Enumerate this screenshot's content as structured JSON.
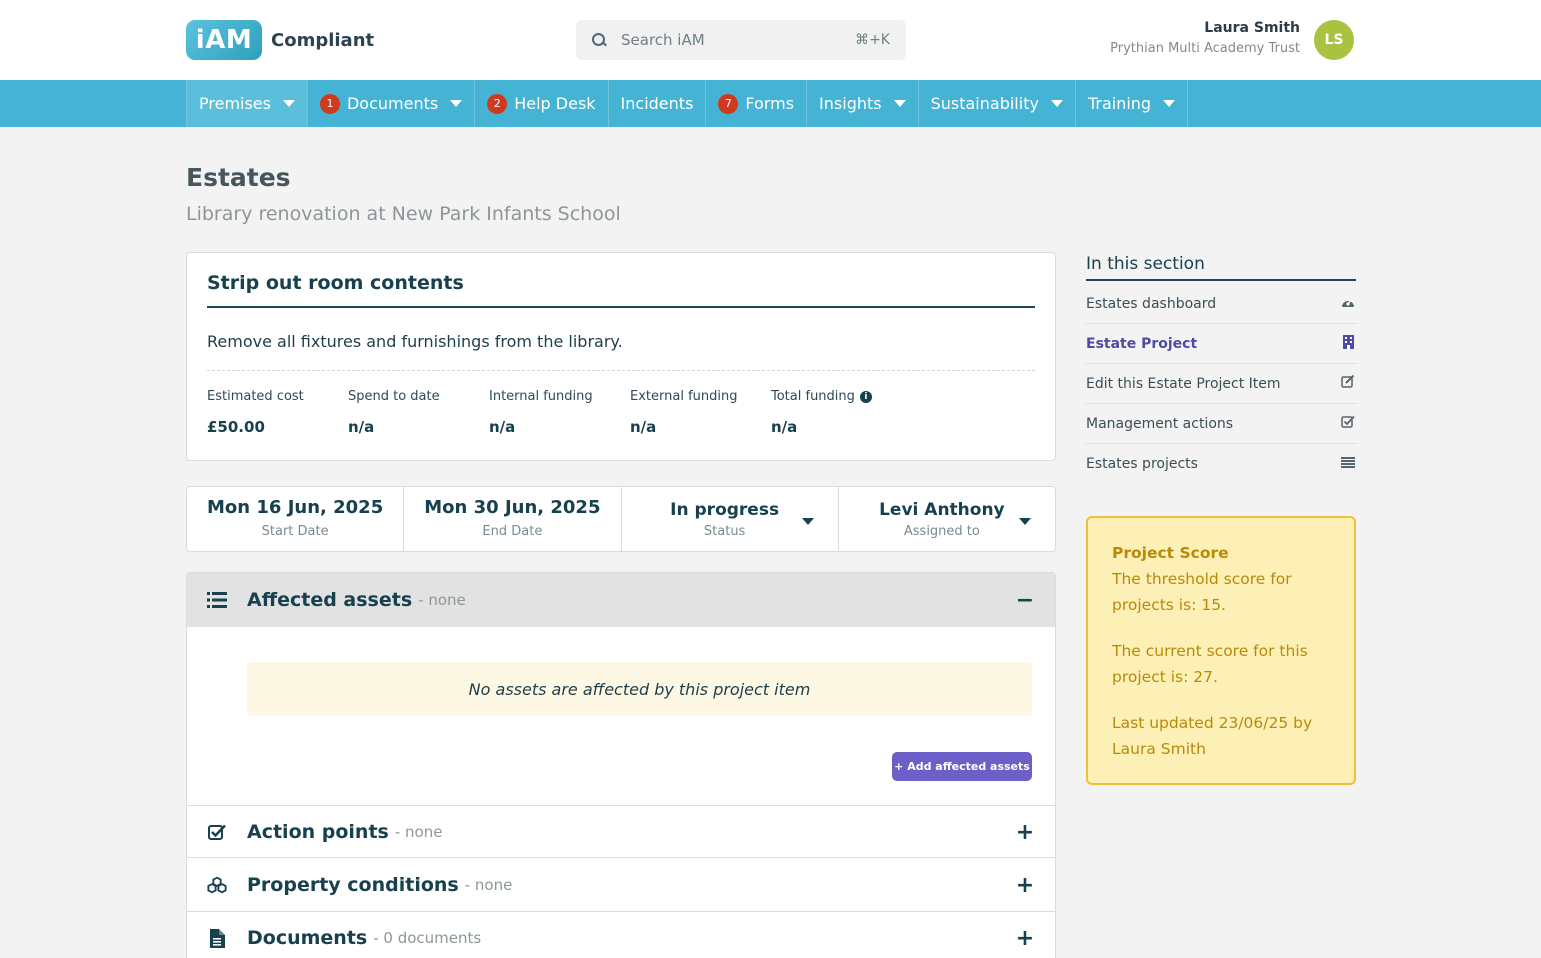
{
  "header": {
    "logo_mark": "iAM",
    "logo_text": "Compliant",
    "search": {
      "placeholder": "Search iAM",
      "shortcut": "⌘+K"
    },
    "user": {
      "name": "Laura Smith",
      "organisation": "Prythian Multi Academy Trust",
      "initials": "LS"
    }
  },
  "nav": {
    "items": [
      {
        "label": "Premises",
        "badge": "",
        "dropdown": true
      },
      {
        "label": "Documents",
        "badge": "1",
        "dropdown": true
      },
      {
        "label": "Help Desk",
        "badge": "2",
        "dropdown": false
      },
      {
        "label": "Incidents",
        "badge": "",
        "dropdown": false
      },
      {
        "label": "Forms",
        "badge": "7",
        "dropdown": false
      },
      {
        "label": "Insights",
        "badge": "",
        "dropdown": true
      },
      {
        "label": "Sustainability",
        "badge": "",
        "dropdown": true
      },
      {
        "label": "Training",
        "badge": "",
        "dropdown": true
      }
    ]
  },
  "page": {
    "title": "Estates",
    "subtitle": "Library renovation at New Park Infants School"
  },
  "item": {
    "title": "Strip out room contents",
    "description": "Remove all fixtures and furnishings from the library.",
    "financials": [
      {
        "label": "Estimated cost",
        "value": "£50.00"
      },
      {
        "label": "Spend to date",
        "value": "n/a"
      },
      {
        "label": "Internal funding",
        "value": "n/a"
      },
      {
        "label": "External funding",
        "value": "n/a"
      },
      {
        "label": "Total funding",
        "value": "n/a"
      }
    ]
  },
  "dates": {
    "start": {
      "value": "Mon 16 Jun, 2025",
      "label": "Start Date"
    },
    "end": {
      "value": "Mon 30 Jun, 2025",
      "label": "End Date"
    },
    "status": {
      "value": "In progress",
      "label": "Status"
    },
    "assigned": {
      "value": "Levi Anthony",
      "label": "Assigned to"
    }
  },
  "sections": {
    "affected_assets": {
      "title": "Affected assets",
      "count": "- none",
      "toggle": "−",
      "empty_message": "No assets are affected by this project item",
      "add_button": "+ Add affected assets"
    },
    "action_points": {
      "title": "Action points",
      "count": "- none",
      "toggle": "+"
    },
    "property_conditions": {
      "title": "Property conditions",
      "count": "- none",
      "toggle": "+"
    },
    "documents": {
      "title": "Documents",
      "count": "- 0 documents",
      "toggle": "+"
    }
  },
  "sidebar": {
    "title": "In this section",
    "items": [
      {
        "label": "Estates dashboard",
        "icon": "dashboard-icon"
      },
      {
        "label": "Estate Project",
        "icon": "building-icon"
      },
      {
        "label": "Edit this Estate Project Item",
        "icon": "edit-icon"
      },
      {
        "label": "Management actions",
        "icon": "checkbox-icon"
      },
      {
        "label": "Estates projects",
        "icon": "list-icon"
      }
    ]
  },
  "score": {
    "title": "Project Score",
    "threshold": "The threshold score for projects is: 15.",
    "current": "The current score for this project is: 27.",
    "updated": "Last updated 23/06/25 by Laura Smith"
  },
  "colors": {
    "brand": "#45b3d3",
    "primary_text": "#17414e",
    "badge": "#d1391c",
    "button": "#6c5fc7",
    "score_bg": "#fdf0b7",
    "score_border": "#efc13a",
    "avatar": "#a9c23f"
  }
}
